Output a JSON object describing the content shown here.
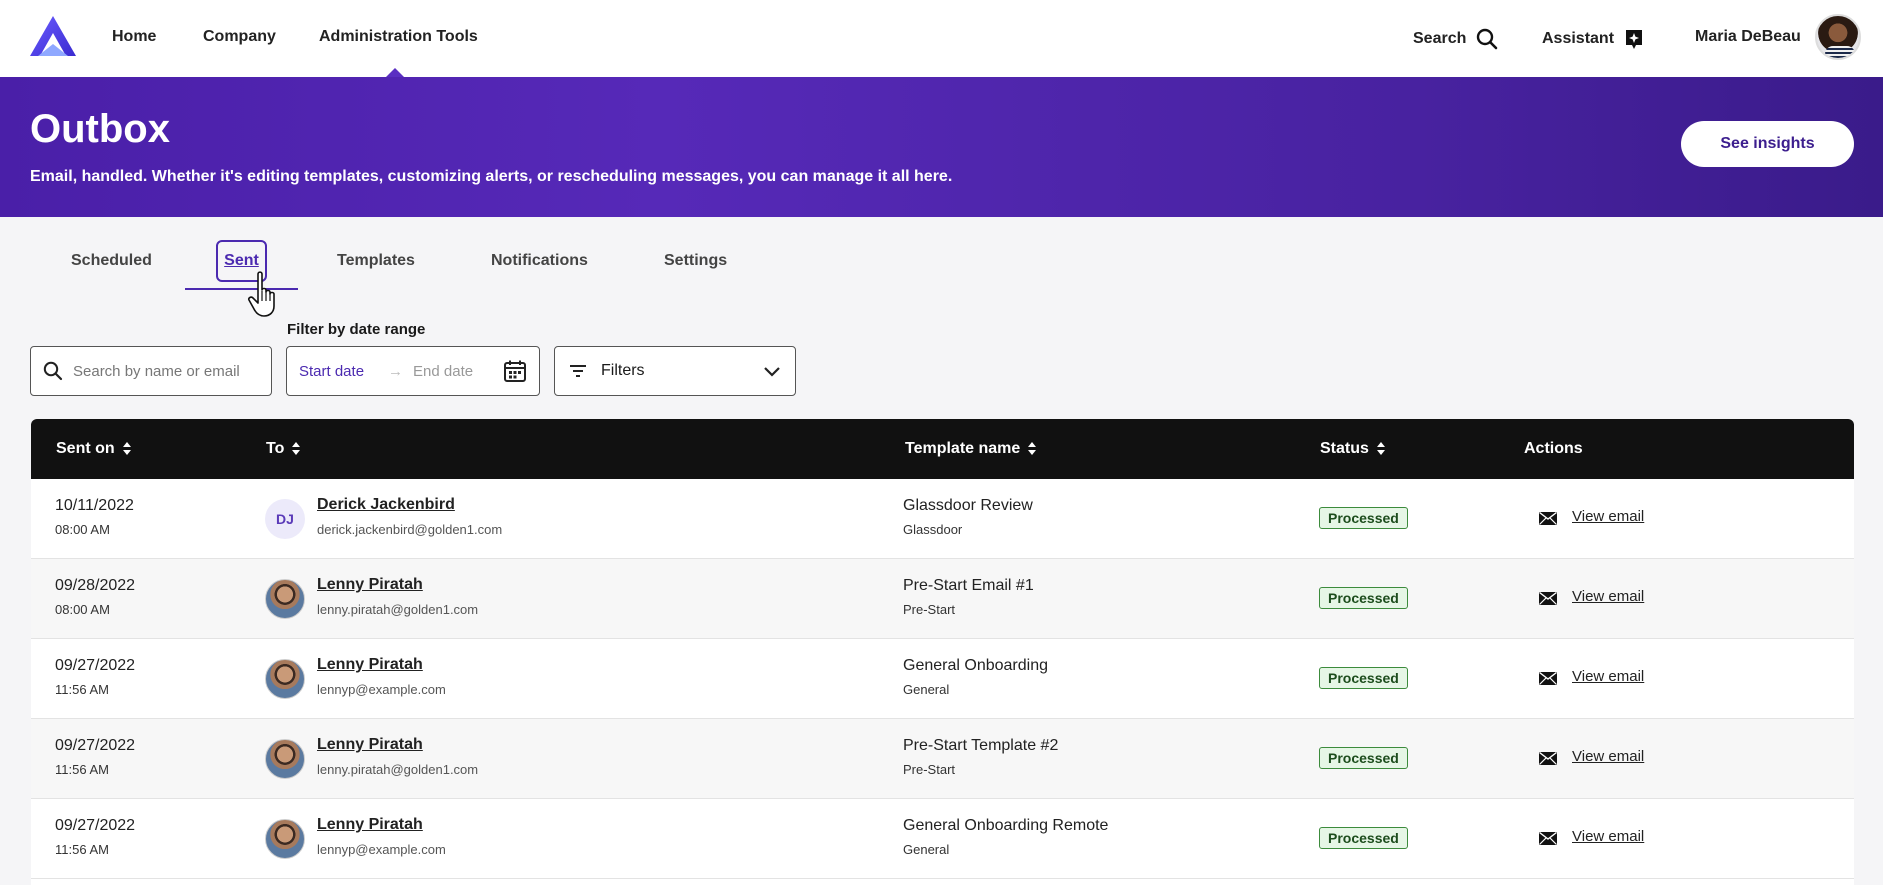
{
  "nav": {
    "links": [
      "Home",
      "Company",
      "Administration Tools"
    ],
    "search_label": "Search",
    "assistant_label": "Assistant",
    "user_name": "Maria DeBeau"
  },
  "hero": {
    "title": "Outbox",
    "subtitle": "Email, handled. Whether it's editing templates, customizing alerts, or rescheduling messages, you can manage it all here.",
    "insights_label": "See insights"
  },
  "tabs": {
    "items": [
      "Scheduled",
      "Sent",
      "Templates",
      "Notifications",
      "Settings"
    ],
    "active": "Sent"
  },
  "filters": {
    "date_range_label": "Filter by date range",
    "search_placeholder": "Search by name or email",
    "start_placeholder": "Start date",
    "end_placeholder": "End date",
    "filters_label": "Filters"
  },
  "table": {
    "headers": [
      "Sent on",
      "To",
      "Template name",
      "Status",
      "Actions"
    ],
    "rows": [
      {
        "date": "10/11/2022",
        "time": "08:00 AM",
        "initials": "DJ",
        "name": "Derick Jackenbird",
        "email": "derick.jackenbird@golden1.com",
        "template": "Glassdoor Review",
        "template_group": "Glassdoor",
        "status": "Processed",
        "action": "View email"
      },
      {
        "date": "09/28/2022",
        "time": "08:00 AM",
        "initials": "",
        "name": "Lenny Piratah",
        "email": "lenny.piratah@golden1.com",
        "template": "Pre-Start Email #1",
        "template_group": "Pre-Start",
        "status": "Processed",
        "action": "View email"
      },
      {
        "date": "09/27/2022",
        "time": "11:56 AM",
        "initials": "",
        "name": "Lenny Piratah",
        "email": "lennyp@example.com",
        "template": "General Onboarding",
        "template_group": "General",
        "status": "Processed",
        "action": "View email"
      },
      {
        "date": "09/27/2022",
        "time": "11:56 AM",
        "initials": "",
        "name": "Lenny Piratah",
        "email": "lenny.piratah@golden1.com",
        "template": "Pre-Start Template #2",
        "template_group": "Pre-Start",
        "status": "Processed",
        "action": "View email"
      },
      {
        "date": "09/27/2022",
        "time": "11:56 AM",
        "initials": "",
        "name": "Lenny Piratah",
        "email": "lennyp@example.com",
        "template": "General Onboarding Remote",
        "template_group": "General",
        "status": "Processed",
        "action": "View email"
      }
    ]
  },
  "colors": {
    "brand_purple": "#4b2ab0",
    "hero_gradient_start": "#4a1fa8",
    "hero_gradient_end": "#3a1b8a",
    "status_processed_bg": "#e6f6e6",
    "status_processed_border": "#3c8b3c"
  }
}
